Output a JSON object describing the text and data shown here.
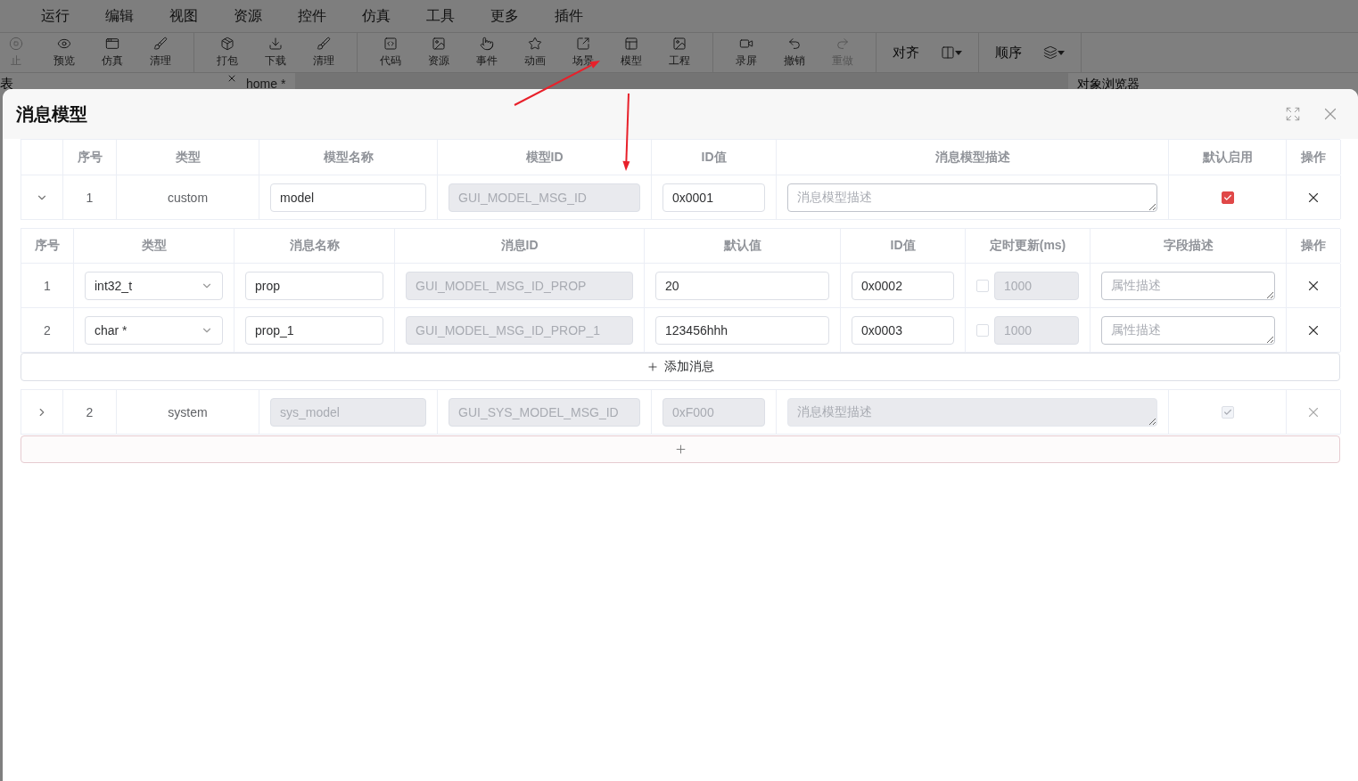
{
  "menu": [
    "运行",
    "编辑",
    "视图",
    "资源",
    "控件",
    "仿真",
    "工具",
    "更多",
    "插件"
  ],
  "toolbar": {
    "groups": [
      {
        "items": [
          {
            "label": "止",
            "disabled": true
          },
          {
            "label": "预览",
            "disabled": false
          },
          {
            "label": "仿真",
            "disabled": false
          },
          {
            "label": "清理",
            "disabled": false
          }
        ]
      },
      {
        "items": [
          {
            "label": "打包",
            "disabled": false
          },
          {
            "label": "下载",
            "disabled": false
          },
          {
            "label": "清理",
            "disabled": false
          }
        ]
      },
      {
        "items": [
          {
            "label": "代码",
            "disabled": false
          },
          {
            "label": "资源",
            "disabled": false
          },
          {
            "label": "事件",
            "disabled": false
          },
          {
            "label": "动画",
            "disabled": false
          },
          {
            "label": "场景",
            "disabled": false
          },
          {
            "label": "模型",
            "disabled": false
          },
          {
            "label": "工程",
            "disabled": false
          }
        ]
      },
      {
        "items": [
          {
            "label": "录屏",
            "disabled": false
          },
          {
            "label": "撤销",
            "disabled": false
          },
          {
            "label": "重做",
            "disabled": true
          }
        ]
      }
    ],
    "dropdowns": [
      {
        "label": "对齐"
      },
      {
        "label": "顺序"
      }
    ]
  },
  "tab_strip": {
    "left_label": "表",
    "tabs": [
      {
        "label": "home *",
        "selected": true
      }
    ],
    "right_title": "对象浏览器"
  },
  "dialog": {
    "title": "消息模型",
    "columns": [
      "序号",
      "类型",
      "模型名称",
      "模型ID",
      "ID值",
      "消息模型描述",
      "默认启用",
      "操作"
    ],
    "message_columns": [
      "序号",
      "类型",
      "消息名称",
      "消息ID",
      "默认值",
      "ID值",
      "定时更新(ms)",
      "字段描述",
      "操作"
    ],
    "models": [
      {
        "expanded": true,
        "index": "1",
        "type": "custom",
        "name": {
          "value": "model",
          "disabled": false
        },
        "model_id": {
          "value": "GUI_MODEL_MSG_ID",
          "disabled": true
        },
        "id_value": {
          "value": "0x0001",
          "disabled": false
        },
        "description": {
          "placeholder": "消息模型描述",
          "disabled": false
        },
        "enabled": {
          "checked": true,
          "disabled": false
        },
        "messages": [
          {
            "index": "1",
            "type": "int32_t",
            "name": "prop",
            "message_id": "GUI_MODEL_MSG_ID_PROP",
            "default": "20",
            "id_value": "0x0002",
            "timer": {
              "checked": false,
              "value": "1000"
            },
            "description_placeholder": "属性描述"
          },
          {
            "index": "2",
            "type": "char *",
            "name": "prop_1",
            "message_id": "GUI_MODEL_MSG_ID_PROP_1",
            "default": "123456hhh",
            "id_value": "0x0003",
            "timer": {
              "checked": false,
              "value": "1000"
            },
            "description_placeholder": "属性描述"
          }
        ],
        "add_message_label": "添加消息"
      },
      {
        "expanded": false,
        "index": "2",
        "type": "system",
        "name": {
          "value": "sys_model",
          "disabled": true
        },
        "model_id": {
          "value": "GUI_SYS_MODEL_MSG_ID",
          "disabled": true
        },
        "id_value": {
          "value": "0xF000",
          "disabled": true
        },
        "description": {
          "placeholder": "消息模型描述",
          "disabled": true
        },
        "enabled": {
          "checked": true,
          "disabled": true
        }
      }
    ]
  },
  "annotations": [
    {
      "kind": "arrow"
    },
    {
      "kind": "arrow"
    }
  ]
}
